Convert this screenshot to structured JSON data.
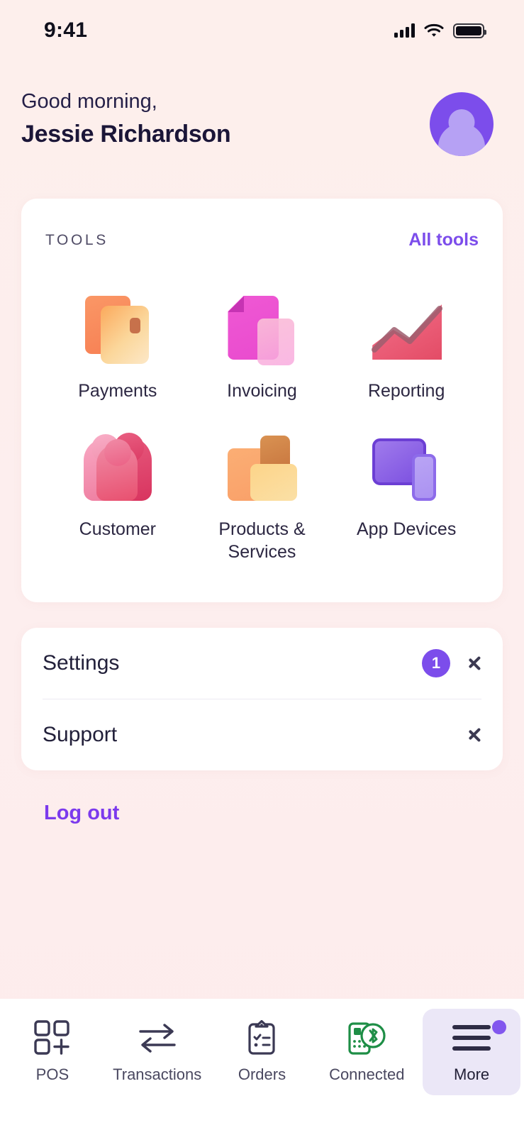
{
  "status_bar": {
    "time": "9:41",
    "signal_icon": "cellular-signal-icon",
    "wifi_icon": "wifi-icon",
    "battery_icon": "battery-full-icon"
  },
  "header": {
    "greeting": "Good morning,",
    "user_name": "Jessie Richardson",
    "avatar_icon": "user-avatar-icon"
  },
  "tools_card": {
    "section_title": "TOOLS",
    "all_tools_link": "All tools",
    "items": [
      {
        "label": "Payments",
        "icon": "payment-cards-icon"
      },
      {
        "label": "Invoicing",
        "icon": "invoice-document-icon"
      },
      {
        "label": "Reporting",
        "icon": "area-chart-icon"
      },
      {
        "label": "Customer",
        "icon": "customers-people-icon"
      },
      {
        "label": "Products & Services",
        "icon": "product-boxes-icon"
      },
      {
        "label": "App Devices",
        "icon": "tablet-phone-icon"
      }
    ]
  },
  "menu_card": {
    "rows": [
      {
        "label": "Settings",
        "badge": "1",
        "chevron_icon": "chevron-right-icon"
      },
      {
        "label": "Support",
        "badge": "",
        "chevron_icon": "chevron-right-icon"
      }
    ]
  },
  "logout": {
    "label": "Log out"
  },
  "tab_bar": {
    "tabs": [
      {
        "label": "POS",
        "icon": "pos-grid-plus-icon",
        "active": false,
        "has_dot": false
      },
      {
        "label": "Transactions",
        "icon": "transfer-arrows-icon",
        "active": false,
        "has_dot": false
      },
      {
        "label": "Orders",
        "icon": "clipboard-list-icon",
        "active": false,
        "has_dot": false
      },
      {
        "label": "Connected",
        "icon": "bluetooth-reader-icon",
        "active": false,
        "has_dot": false
      },
      {
        "label": "More",
        "icon": "hamburger-menu-icon",
        "active": true,
        "has_dot": true
      }
    ]
  },
  "colors": {
    "background": "#FDEEEE",
    "card": "#FFFFFF",
    "accent_purple": "#7C4DEB",
    "logout_purple": "#7C3AED",
    "text_dark": "#1B1638",
    "connected_green": "#1E8E46",
    "tab_active_bg": "#EBE7F7"
  }
}
